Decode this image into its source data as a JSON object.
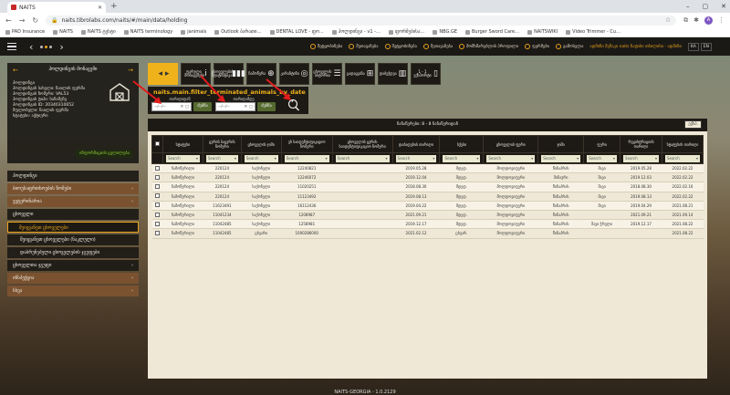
{
  "browser": {
    "tab_title": "NAITS",
    "url": "naits.tibrolabs.com/naits/#/main/data/holding",
    "profile_initial": "A",
    "bookmarks": [
      "PAD Insurance",
      "NAITS",
      "NAITS ტესტი",
      "NAITS terminology",
      "janimals",
      "Outlook ბარათი…",
      "DENTAL LOVE - ფო…",
      "ჰოლდინგი - v1 -…",
      "ფორმებისა…",
      "NBG.GE",
      "Burger Sword Care…",
      "NAITSWIKI",
      "Video Trimmer - Cu…"
    ]
  },
  "header": {
    "menu_items": [
      "შეტყობინება",
      "შეთავაზება",
      "შეტყობინება",
      "შეთავაზება",
      "მომხმარებლის პროფილი",
      "ფერმები",
      "გამოსვლა"
    ],
    "user": "ადმინი მუშაკი naits ნატისი თბილისი - ადმინი",
    "lang_ka": "KA",
    "lang_en": "EN"
  },
  "sidebar": {
    "title": "ჰოლდინგის მონაცემი",
    "profile_lines": [
      "ჰოლდინგი",
      "ჰოლდინგის სახელი: ნაილის ფერმა",
      "ჰოლდინგის ნომერი: VAL53",
      "ჰოლდინგის ტიპი: სანაშენე",
      "ჰოლდინგის ID: 20340310652",
      "მფლობელი: ნაილის ფერმა",
      "სტატუსი: აქტიური"
    ],
    "green_link": "ინფორმაციის ცვლილება",
    "menu": [
      {
        "label": "ჰოლდინგი",
        "style": "dark",
        "chevron": ""
      },
      {
        "label": "ბიოუსაფრთხოების ზომები",
        "style": "brown",
        "chevron": "›"
      },
      {
        "label": "ვეტერინარია",
        "style": "brown",
        "chevron": "›"
      },
      {
        "label": "ცხოველი",
        "style": "dark",
        "chevron": ""
      },
      {
        "label": "შეიყვანეთ ცხოველები",
        "style": "sel",
        "chevron": ""
      },
      {
        "label": "შეიყვანეთ ცხოველები (ნაკლული)",
        "style": "sub",
        "chevron": ""
      },
      {
        "label": "დაბრუნებული ცხოველების ჯგუფები",
        "style": "sub",
        "chevron": ""
      },
      {
        "label": "ცხოველთა ჯგუფი",
        "style": "dark",
        "chevron": "›"
      },
      {
        "label": "ინსპექცია",
        "style": "brown",
        "chevron": "›"
      },
      {
        "label": "სხვა",
        "style": "brown",
        "chevron": "›"
      }
    ]
  },
  "toolbar": {
    "buttons": [
      {
        "label": "",
        "glyph": "◂ ▸",
        "style": "yellow"
      },
      {
        "label": "ფარული მონაცემები",
        "glyph": "i",
        "style": "dark"
      },
      {
        "label": "ცხოველების სტატისტიკა",
        "glyph": "▮▮▮",
        "style": "dark"
      },
      {
        "label": "ჩამოწერა",
        "glyph": "⊕",
        "style": "dark"
      },
      {
        "label": "კარანტინი",
        "glyph": "◎",
        "style": "dark"
      },
      {
        "label": "ცხოველის ისტორია",
        "glyph": "☰",
        "style": "dark"
      },
      {
        "label": "გადაყვანა",
        "glyph": "⊞",
        "style": "dark"
      },
      {
        "label": "დაბეჭდვა",
        "glyph": "▥",
        "style": "dark"
      },
      {
        "label": "1 - 1 ექსპორტი",
        "glyph": "▯",
        "style": "dark"
      }
    ]
  },
  "filter": {
    "key": "naits.main.filter_terminated_animals_by_date",
    "from_label": "თარიღიდან",
    "to_label": "თარიღამდე",
    "date_placeholder": "--/--/--",
    "ok_label": "ძებნა"
  },
  "grid": {
    "pager_info": "ჩანაწერები: 8 - 8 ჩანაწერიდან",
    "export_label": "ექსპ.",
    "filter_placeholder": "Search",
    "columns": [
      "",
      "სტატუსი",
      "ყურის საყურის ნომერი",
      "ცხოველის ჯიში",
      "ეს საიდენტიფიკაციო ნომერი",
      "ცხოველის ყურის საიდენტიფიკაციო ნომერი",
      "დაბადების თარიღი",
      "სქესი",
      "ცხოველის ფერი",
      "ჯიში",
      "ფერი",
      "რეგისტრაციის თარიღი",
      "სტატუსის თარიღი"
    ],
    "rows": [
      [
        "ჩამოწერილი",
        "220124",
        "საქონელი",
        "12240821",
        "2019.05.28",
        "მდედ.",
        "მოლდოვიფერი",
        "წინაპრის",
        "შავი",
        "2019.05.28",
        "2022.02.22"
      ],
      [
        "ჩამოწერილი",
        "220124",
        "საქონელი",
        "12246072",
        "2019.12.04",
        "მდედ.",
        "მოლდოვიფერი",
        "შინაური",
        "შავი",
        "2019.12.03",
        "2022.02.22"
      ],
      [
        "ჩამოწერილი",
        "220124",
        "საქონელი",
        "11020251",
        "2018.08.30",
        "მდედ.",
        "მოლდოვიფერი",
        "წინაპრის",
        "შავი",
        "2018.08.30",
        "2022.02.16"
      ],
      [
        "ჩამოწერილი",
        "220124",
        "საქონელი",
        "11123492",
        "2019.08.13",
        "მდედ.",
        "მოლდოვიფერი",
        "წინაპრის",
        "შავი",
        "2019.08.13",
        "2022.02.22"
      ],
      [
        "ჩამოწერილი",
        "11623491",
        "საქონელი",
        "16112436",
        "2019.04.22",
        "მდედ.",
        "მოლდოვიფერი",
        "წინაპრის",
        "შავი",
        "2019.04.29",
        "2021.08.21"
      ],
      [
        "ჩამოწერილი",
        "11041234",
        "საქონელი",
        "1208987",
        "2021.09.21",
        "მდედ.",
        "მოლდოვიფერი",
        "წინაპრის",
        "",
        "2021.09.21",
        "2021.09.14"
      ],
      [
        "ჩამოწერილი",
        "11042485",
        "საქონელი",
        "1258981",
        "2019.12.17",
        "მდედ.",
        "მოლდოვიფერი",
        "წინაპრის",
        "შავი ჭრელი",
        "2019.12.17",
        "2021.08.22"
      ],
      [
        "ჩამოწერილი",
        "11042485",
        "ცხვარი",
        "1000286000",
        "2021.02.12",
        "ცხვარ.",
        "მოლდოვიფერი",
        "წინაპრის",
        "",
        "",
        "2021.08.22"
      ]
    ]
  },
  "footer": "NAITS-GEORGIA - 1.0.2129"
}
